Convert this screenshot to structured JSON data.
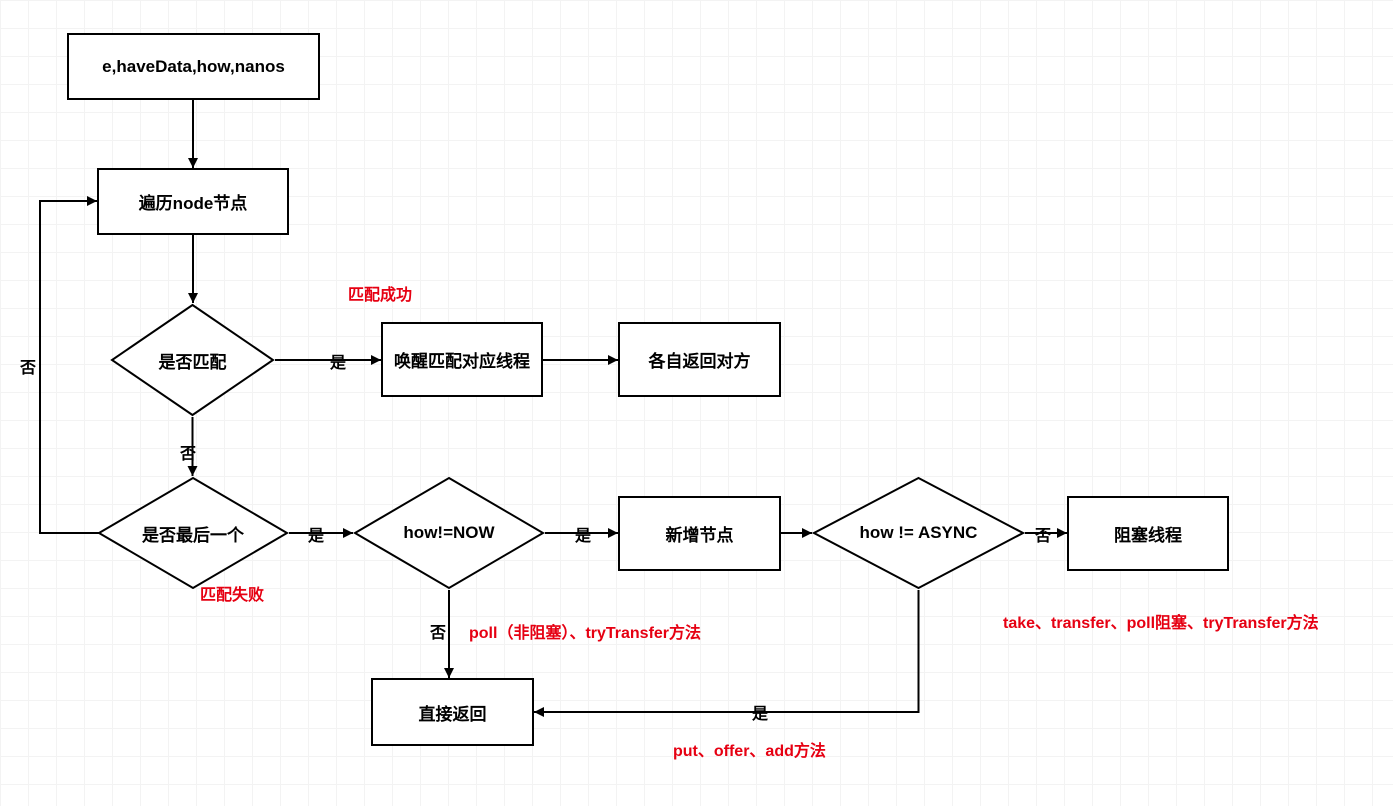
{
  "nodes": {
    "start": "e,haveData,how,nanos",
    "traverse": "遍历node节点",
    "match_q": "是否匹配",
    "wakeup": "唤醒匹配对应线程",
    "each_return": "各自返回对方",
    "last_q": "是否最后一个",
    "how_now": "how!=NOW",
    "new_node": "新增节点",
    "how_async": "how != ASYNC",
    "block_thread": "阻塞线程",
    "direct_return": "直接返回"
  },
  "edges": {
    "yes": "是",
    "no": "否"
  },
  "notes": {
    "match_ok": "匹配成功",
    "match_fail": "匹配失败",
    "poll_try": "poll（非阻塞）、tryTransfer方法",
    "put_offer_add": "put、offer、add方法",
    "take_transfer": "take、transfer、poll阻塞、tryTransfer方法"
  }
}
